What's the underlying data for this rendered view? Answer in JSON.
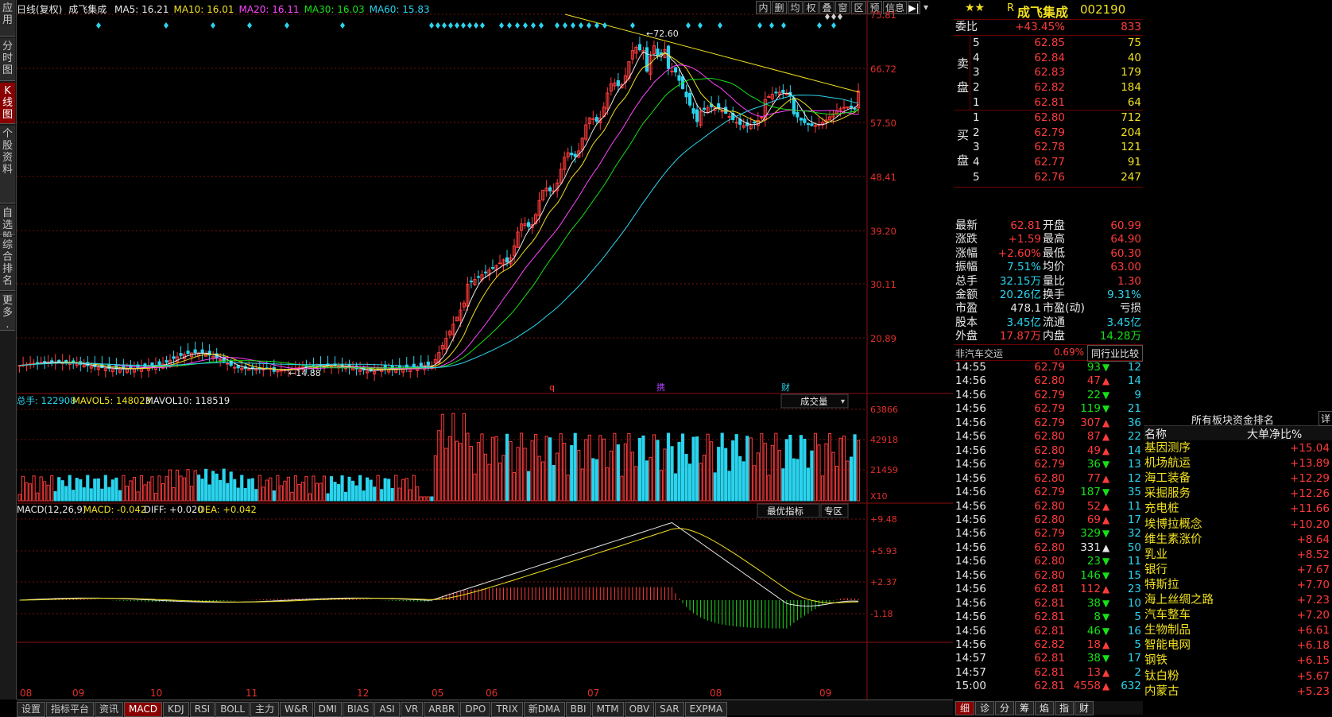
{
  "left_tabs": [
    "应用",
    "分时图",
    "K线图",
    "个股资料",
    "自选股",
    "综合排名",
    "更多."
  ],
  "chart_header": {
    "period": "日线(复权)",
    "name": "成飞集成",
    "ma": [
      {
        "label": "MA5: 16.21",
        "color": "#e8e8e8"
      },
      {
        "label": "MA10: 16.01",
        "color": "#f0e020"
      },
      {
        "label": "MA20: 16.11",
        "color": "#ff44ff"
      },
      {
        "label": "MA30: 16.03",
        "color": "#16e016"
      },
      {
        "label": "MA60: 15.83",
        "color": "#2ad4ee"
      }
    ]
  },
  "toolbar": [
    "内",
    "删",
    "均",
    "权",
    "叠",
    "窗",
    "区",
    "预",
    "信息"
  ],
  "price_axis": [
    "75.81",
    "66.72",
    "57.50",
    "48.41",
    "39.20",
    "30.11",
    "20.89"
  ],
  "annotations": {
    "high": "72.60",
    "low": "14.88",
    "markers": [
      "q",
      "携",
      "财"
    ]
  },
  "volume": {
    "header": {
      "total": "总手: 122908",
      "mavol5": "MAVOL5: 148023",
      "mavol10": "MAVOL10: 118519"
    },
    "selector": "成交量",
    "axis": [
      "63866",
      "42918",
      "21459",
      "X10"
    ]
  },
  "macd": {
    "header": {
      "name": "MACD(12,26,9)",
      "macd": "MACD: -0.042",
      "diff": "DIFF: +0.020",
      "dea": "DEA: +0.042"
    },
    "buttons": [
      "最优指标",
      "专区"
    ],
    "axis": [
      "+9.48",
      "+5.93",
      "+2.37",
      "-1.18"
    ]
  },
  "x_axis": [
    "08",
    "09",
    "10",
    "11",
    "12",
    "05",
    "06",
    "07",
    "08",
    "09"
  ],
  "bottom_tabs": [
    "设置",
    "指标平台",
    "资讯",
    "MACD",
    "KDJ",
    "RSI",
    "BOLL",
    "主力",
    "W&R",
    "DMI",
    "BIAS",
    "ASI",
    "VR",
    "ARBR",
    "DPO",
    "TRIX",
    "新DMA",
    "BBI",
    "MTM",
    "OBV",
    "SAR",
    "EXPMA"
  ],
  "stock": {
    "stars": "★★",
    "r": "R",
    "name": "成飞集成",
    "code": "002190"
  },
  "weibi": {
    "label": "委比",
    "pct": "+43.45%",
    "val": "833"
  },
  "asks": [
    {
      "n": "5",
      "p": "62.85",
      "v": "75"
    },
    {
      "n": "4",
      "p": "62.84",
      "v": "40"
    },
    {
      "n": "3",
      "p": "62.83",
      "v": "179"
    },
    {
      "n": "2",
      "p": "62.82",
      "v": "184"
    },
    {
      "n": "1",
      "p": "62.81",
      "v": "64"
    }
  ],
  "bids": [
    {
      "n": "1",
      "p": "62.80",
      "v": "712"
    },
    {
      "n": "2",
      "p": "62.79",
      "v": "204"
    },
    {
      "n": "3",
      "p": "62.78",
      "v": "121"
    },
    {
      "n": "4",
      "p": "62.77",
      "v": "91"
    },
    {
      "n": "5",
      "p": "62.76",
      "v": "247"
    }
  ],
  "ask_label": [
    "卖",
    "盘"
  ],
  "bid_label": [
    "买",
    "盘"
  ],
  "quote": [
    {
      "l1": "最新",
      "v1": "62.81",
      "c1": "red",
      "l2": "开盘",
      "v2": "60.99",
      "c2": "red"
    },
    {
      "l1": "涨跌",
      "v1": "+1.59",
      "c1": "red",
      "l2": "最高",
      "v2": "64.90",
      "c2": "red"
    },
    {
      "l1": "涨幅",
      "v1": "+2.60%",
      "c1": "red",
      "l2": "最低",
      "v2": "60.30",
      "c2": "red"
    },
    {
      "l1": "振幅",
      "v1": "7.51%",
      "c1": "cyan",
      "l2": "均价",
      "v2": "63.00",
      "c2": "red"
    },
    {
      "l1": "总手",
      "v1": "32.15万",
      "c1": "cyan",
      "l2": "量比",
      "v2": "1.30",
      "c2": "red"
    },
    {
      "l1": "金额",
      "v1": "20.26亿",
      "c1": "cyan",
      "l2": "换手",
      "v2": "9.31%",
      "c2": "cyan"
    },
    {
      "l1": "市盈",
      "v1": "478.1",
      "c1": "wht",
      "l2": "市盈(动)",
      "v2": "亏损",
      "c2": "wht"
    },
    {
      "l1": "股本",
      "v1": "3.45亿",
      "c1": "cyan",
      "l2": "流通",
      "v2": "3.45亿",
      "c2": "cyan"
    },
    {
      "l1": "外盘",
      "v1": "17.87万",
      "c1": "red",
      "l2": "内盘",
      "v2": "14.28万",
      "c2": "grn"
    }
  ],
  "sector": {
    "name": "非汽车交运",
    "pct": "0.69%",
    "compare": "同行业比较"
  },
  "ticks": [
    {
      "t": "14:55",
      "p": "62.79",
      "v": "93",
      "d": "down",
      "n": "12"
    },
    {
      "t": "14:56",
      "p": "62.80",
      "v": "47",
      "d": "up",
      "n": "14"
    },
    {
      "t": "14:56",
      "p": "62.79",
      "v": "22",
      "d": "down",
      "n": "9"
    },
    {
      "t": "14:56",
      "p": "62.79",
      "v": "119",
      "d": "down",
      "n": "21"
    },
    {
      "t": "14:56",
      "p": "62.79",
      "v": "307",
      "d": "up",
      "n": "36"
    },
    {
      "t": "14:56",
      "p": "62.80",
      "v": "87",
      "d": "up",
      "n": "22"
    },
    {
      "t": "14:56",
      "p": "62.80",
      "v": "49",
      "d": "up",
      "n": "14"
    },
    {
      "t": "14:56",
      "p": "62.79",
      "v": "36",
      "d": "down",
      "n": "13"
    },
    {
      "t": "14:56",
      "p": "62.80",
      "v": "77",
      "d": "up",
      "n": "12"
    },
    {
      "t": "14:56",
      "p": "62.79",
      "v": "187",
      "d": "down",
      "n": "35"
    },
    {
      "t": "14:56",
      "p": "62.80",
      "v": "52",
      "d": "up",
      "n": "11"
    },
    {
      "t": "14:56",
      "p": "62.80",
      "v": "69",
      "d": "up",
      "n": "17"
    },
    {
      "t": "14:56",
      "p": "62.79",
      "v": "329",
      "d": "down",
      "n": "32"
    },
    {
      "t": "14:56",
      "p": "62.80",
      "v": "331",
      "d": "up-w",
      "n": "50"
    },
    {
      "t": "14:56",
      "p": "62.80",
      "v": "23",
      "d": "down",
      "n": "11"
    },
    {
      "t": "14:56",
      "p": "62.80",
      "v": "146",
      "d": "down",
      "n": "15"
    },
    {
      "t": "14:56",
      "p": "62.81",
      "v": "112",
      "d": "up",
      "n": "23"
    },
    {
      "t": "14:56",
      "p": "62.81",
      "v": "38",
      "d": "down",
      "n": "10"
    },
    {
      "t": "14:56",
      "p": "62.81",
      "v": "8",
      "d": "down",
      "n": "5"
    },
    {
      "t": "14:56",
      "p": "62.81",
      "v": "46",
      "d": "down",
      "n": "16"
    },
    {
      "t": "14:56",
      "p": "62.82",
      "v": "18",
      "d": "up",
      "n": "5"
    },
    {
      "t": "14:57",
      "p": "62.81",
      "v": "38",
      "d": "down",
      "n": "17"
    },
    {
      "t": "14:57",
      "p": "62.81",
      "v": "13",
      "d": "up",
      "n": "2"
    },
    {
      "t": "15:00",
      "p": "62.81",
      "v": "4558",
      "d": "up",
      "n": "632"
    }
  ],
  "tick_tabs": [
    "细",
    "诊",
    "分",
    "筹",
    "焰",
    "指",
    "财"
  ],
  "fund_rank": {
    "title": "所有板块资金排名",
    "detail": "详",
    "col1": "名称",
    "col2": "大单净比%",
    "items": [
      {
        "name": "基因测序",
        "val": "+15.04"
      },
      {
        "name": "机场航运",
        "val": "+13.89"
      },
      {
        "name": "海工装备",
        "val": "+12.29"
      },
      {
        "name": "采掘服务",
        "val": "+12.26"
      },
      {
        "name": "充电桩",
        "val": "+11.66"
      },
      {
        "name": "埃博拉概念",
        "val": "+10.20"
      },
      {
        "name": "维生素涨价",
        "val": "+8.64"
      },
      {
        "name": "乳业",
        "val": "+8.52"
      },
      {
        "name": "银行",
        "val": "+7.67"
      },
      {
        "name": "特斯拉",
        "val": "+7.70"
      },
      {
        "name": "海上丝绸之路",
        "val": "+7.23"
      },
      {
        "name": "汽车整车",
        "val": "+7.20"
      },
      {
        "name": "生物制品",
        "val": "+6.61"
      },
      {
        "name": "智能电网",
        "val": "+6.18"
      },
      {
        "name": "钢铁",
        "val": "+6.15"
      },
      {
        "name": "钛白粉",
        "val": "+5.67"
      },
      {
        "name": "内蒙古",
        "val": "+5.23"
      }
    ]
  }
}
